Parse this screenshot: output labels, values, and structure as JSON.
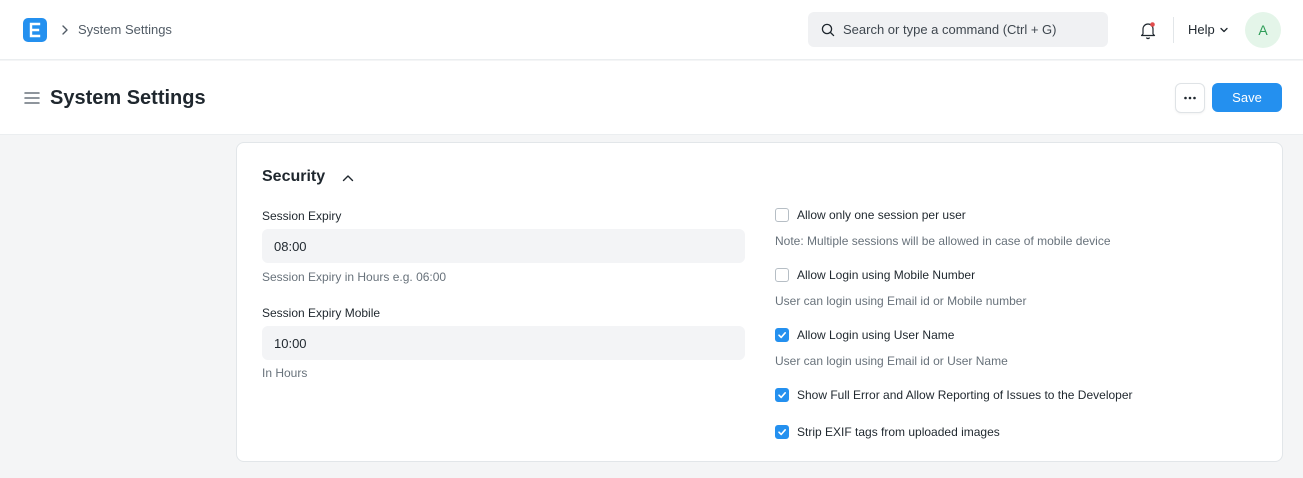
{
  "navbar": {
    "breadcrumb": "System Settings",
    "search_placeholder": "Search or type a command (Ctrl + G)",
    "help_label": "Help",
    "avatar_initial": "A"
  },
  "page": {
    "title": "System Settings",
    "save_label": "Save"
  },
  "security": {
    "title": "Security",
    "fields": [
      {
        "label": "Session Expiry",
        "value": "08:00",
        "description": "Session Expiry in Hours e.g. 06:00"
      },
      {
        "label": "Session Expiry Mobile",
        "value": "10:00",
        "description": "In Hours"
      }
    ],
    "checks": [
      {
        "label": "Allow only one session per user",
        "checked": false,
        "description": "Note: Multiple sessions will be allowed in case of mobile device"
      },
      {
        "label": "Allow Login using Mobile Number",
        "checked": false,
        "description": "User can login using Email id or Mobile number"
      },
      {
        "label": "Allow Login using User Name",
        "checked": true,
        "description": "User can login using Email id or User Name"
      },
      {
        "label": "Show Full Error and Allow Reporting of Issues to the Developer",
        "checked": true,
        "description": ""
      },
      {
        "label": "Strip EXIF tags from uploaded images",
        "checked": true,
        "description": ""
      }
    ]
  },
  "colors": {
    "accent": "#2490ef",
    "background": "#f4f5f6",
    "input_bg": "#f3f4f6"
  },
  "icons": [
    "app-logo-icon",
    "chevron-right-icon",
    "search-icon",
    "bell-icon",
    "chevron-down-icon",
    "hamburger-icon",
    "ellipsis-icon",
    "chevron-up-icon",
    "checkmark-icon"
  ]
}
